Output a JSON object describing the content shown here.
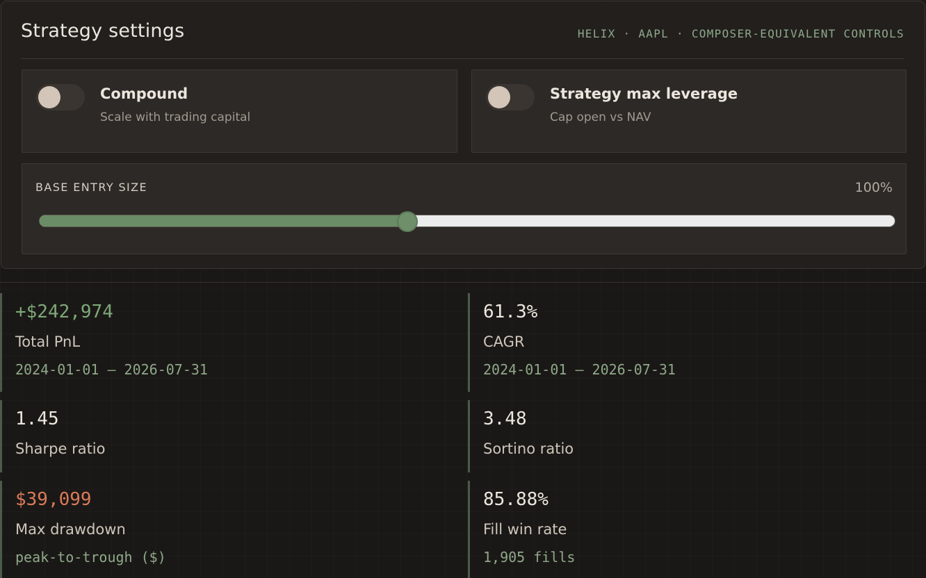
{
  "panel": {
    "title": "Strategy settings",
    "crumb": "HELIX · AAPL · COMPOSER-EQUIVALENT CONTROLS"
  },
  "toggles": [
    {
      "title": "Compound",
      "subtitle": "Scale with trading capital",
      "enabled": false
    },
    {
      "title": "Strategy max leverage",
      "subtitle": "Cap open vs NAV",
      "enabled": false
    }
  ],
  "entry_size": {
    "label": "BASE ENTRY SIZE",
    "value_text": "100%",
    "slider_fraction": 0.43
  },
  "stats": [
    {
      "value": "+$242,974",
      "label": "Total PnL",
      "meta": "2024-01-01 – 2026-07-31",
      "tone": "positive"
    },
    {
      "value": "61.3%",
      "label": "CAGR",
      "meta": "2024-01-01 – 2026-07-31",
      "tone": "neutral"
    },
    {
      "value": "1.45",
      "label": "Sharpe ratio",
      "meta": "",
      "tone": "neutral"
    },
    {
      "value": "3.48",
      "label": "Sortino ratio",
      "meta": "",
      "tone": "neutral"
    },
    {
      "value": "$39,099",
      "label": "Max drawdown",
      "meta": "peak-to-trough ($)",
      "tone": "negative"
    },
    {
      "value": "85.88%",
      "label": "Fill win rate",
      "meta": "1,905 fills",
      "tone": "neutral"
    }
  ],
  "colors": {
    "accent_green": "#7ea979",
    "negative_red": "#d97a5a",
    "meta_green": "#8fa98a",
    "background": "#1a1816",
    "panel": "#221f1d"
  }
}
